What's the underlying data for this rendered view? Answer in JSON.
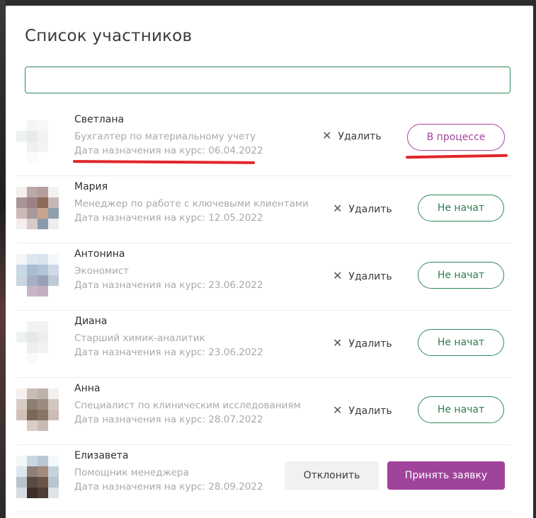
{
  "modal": {
    "title": "Список участников",
    "search": {
      "value": "",
      "placeholder": ""
    }
  },
  "participants": [
    {
      "name": "Светлана",
      "role": "Бухгалтер по материальному учету",
      "date": "Дата назначения на курс: 06.04.2022",
      "delete_label": "Удалить",
      "status": "В процессе",
      "status_color": "#a0459e"
    },
    {
      "name": "Мария",
      "role": "Менеджер по работе с ключевыми клиентами",
      "date": "Дата назначения на курс: 12.05.2022",
      "delete_label": "Удалить",
      "status": "Не начат",
      "status_color": "#2e8b57"
    },
    {
      "name": "Антонина",
      "role": "Экономист",
      "date": "Дата назначения на курс: 23.06.2022",
      "delete_label": "Удалить",
      "status": "Не начат",
      "status_color": "#2e8b57"
    },
    {
      "name": "Диана",
      "role": "Старший химик-аналитик",
      "date": "Дата назначения на курс: 23.06.2022",
      "delete_label": "Удалить",
      "status": "Не начат",
      "status_color": "#2e8b57"
    },
    {
      "name": "Анна",
      "role": "Специалист по клиническим исследованиям",
      "date": "Дата назначения на курс: 28.07.2022",
      "delete_label": "Удалить",
      "status": "Не начат",
      "status_color": "#2e8b57"
    },
    {
      "name": "Елизавета",
      "role": "Помощник менеджера",
      "date": "Дата назначения на курс: 28.09.2022",
      "decline_label": "Отклонить",
      "accept_label": "Принять заявку",
      "accept_color": "#a0439b"
    }
  ],
  "icons": {
    "delete": "close-icon"
  },
  "annotation_color": "#e0262b"
}
